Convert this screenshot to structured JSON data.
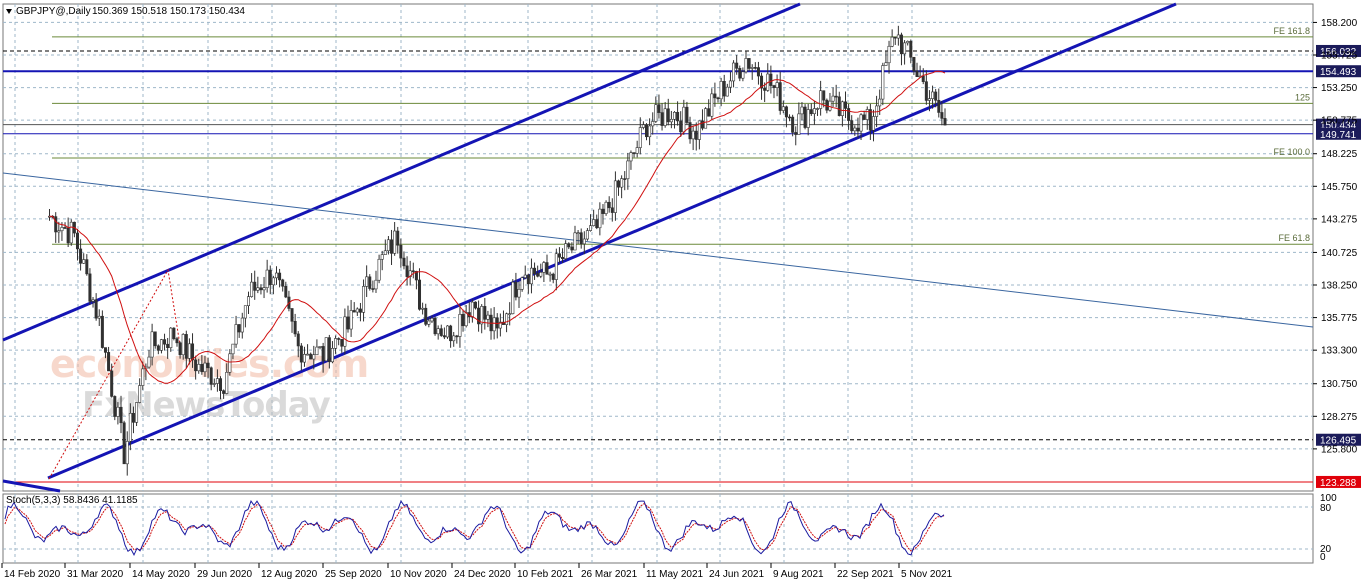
{
  "header": {
    "symbol_label": "GBPJPY@,Daily",
    "ohlc": "150.369 150.518 150.173 150.434"
  },
  "watermark": {
    "line1": "economies.com",
    "line2": "FxNewsToday"
  },
  "stoch": {
    "label": "Stoch(5,3,3) 58.8436 41.1185",
    "levels": [
      "100",
      "80",
      "20",
      "0"
    ]
  },
  "colors": {
    "channel": "#1414b4",
    "grid": "#9fb7c9",
    "ma": "#d01010",
    "fib": "#6b8a3a",
    "candle": "#303030",
    "stoch_main": "#1a1aa0",
    "stoch_signal": "#d01010",
    "red_box": "#e0000a",
    "dark_box": "#1b1b5a"
  },
  "chart_data": {
    "type": "candlestick",
    "title": "GBPJPY@,Daily",
    "ylim": [
      122.6,
      159.6
    ],
    "y_ticks": [
      "158.200",
      "155.725",
      "153.250",
      "150.775",
      "148.225",
      "145.750",
      "143.275",
      "140.725",
      "138.250",
      "135.775",
      "133.300",
      "130.750",
      "128.275",
      "125.800"
    ],
    "x_ticks": [
      "14 Feb 2020",
      "31 Mar 2020",
      "14 May 2020",
      "29 Jun 2020",
      "12 Aug 2020",
      "25 Sep 2020",
      "10 Nov 2020",
      "24 Dec 2020",
      "10 Feb 2021",
      "26 Mar 2021",
      "11 May 2021",
      "24 Jun 2021",
      "9 Aug 2021",
      "22 Sep 2021",
      "5 Nov 2021"
    ],
    "price_levels": [
      {
        "label": "156.032",
        "style": "dashed",
        "box": "dark"
      },
      {
        "label": "154.493",
        "style": "solid",
        "box": "dark"
      },
      {
        "label": "150.434",
        "style": "solid",
        "box": "dark"
      },
      {
        "label": "149.741",
        "style": "solid",
        "box": "dark"
      },
      {
        "label": "126.495",
        "style": "dashed",
        "box": "dark"
      },
      {
        "label": "123.288",
        "style": "solid",
        "box": "red"
      }
    ],
    "fib_levels": [
      {
        "label": "FE 161.8",
        "value": 157.1
      },
      {
        "label": "125",
        "value": 152.05
      },
      {
        "label": "FE 100.0",
        "value": 147.9
      },
      {
        "label": "FE 61.8",
        "value": 141.35
      }
    ],
    "close_series": [
      {
        "date": "14 Feb 2020",
        "close": 143.5
      },
      {
        "date": "25 Feb 2020",
        "close": 142.0
      },
      {
        "date": "5 Mar 2020",
        "close": 135.5
      },
      {
        "date": "18 Mar 2020",
        "close": 125.5
      },
      {
        "date": "31 Mar 2020",
        "close": 133.5
      },
      {
        "date": "14 Apr 2020",
        "close": 134.5
      },
      {
        "date": "29 Apr 2020",
        "close": 132.0
      },
      {
        "date": "14 May 2020",
        "close": 131.0
      },
      {
        "date": "26 May 2020",
        "close": 137.5
      },
      {
        "date": "2 Jun 2020",
        "close": 139.3
      },
      {
        "date": "15 Jun 2020",
        "close": 133.5
      },
      {
        "date": "29 Jun 2020",
        "close": 133.0
      },
      {
        "date": "20 Jul 2020",
        "close": 135.0
      },
      {
        "date": "12 Aug 2020",
        "close": 139.0
      },
      {
        "date": "3 Sep 2020",
        "close": 142.0
      },
      {
        "date": "10 Sep 2020",
        "close": 136.5
      },
      {
        "date": "25 Sep 2020",
        "close": 134.5
      },
      {
        "date": "15 Oct 2020",
        "close": 137.0
      },
      {
        "date": "3 Nov 2020",
        "close": 134.5
      },
      {
        "date": "10 Nov 2020",
        "close": 139.5
      },
      {
        "date": "1 Dec 2020",
        "close": 139.0
      },
      {
        "date": "24 Dec 2020",
        "close": 141.0
      },
      {
        "date": "19 Jan 2021",
        "close": 142.5
      },
      {
        "date": "10 Feb 2021",
        "close": 146.0
      },
      {
        "date": "26 Feb 2021",
        "close": 150.5
      },
      {
        "date": "26 Mar 2021",
        "close": 151.5
      },
      {
        "date": "19 Apr 2021",
        "close": 150.0
      },
      {
        "date": "11 May 2021",
        "close": 153.0
      },
      {
        "date": "1 Jun 2021",
        "close": 155.5
      },
      {
        "date": "24 Jun 2021",
        "close": 153.5
      },
      {
        "date": "20 Jul 2021",
        "close": 150.5
      },
      {
        "date": "9 Aug 2021",
        "close": 152.5
      },
      {
        "date": "30 Aug 2021",
        "close": 151.0
      },
      {
        "date": "22 Sep 2021",
        "close": 150.5
      },
      {
        "date": "20 Oct 2021",
        "close": 157.5
      },
      {
        "date": "1 Nov 2021",
        "close": 154.0
      },
      {
        "date": "19 Nov 2021",
        "close": 150.4
      }
    ]
  }
}
